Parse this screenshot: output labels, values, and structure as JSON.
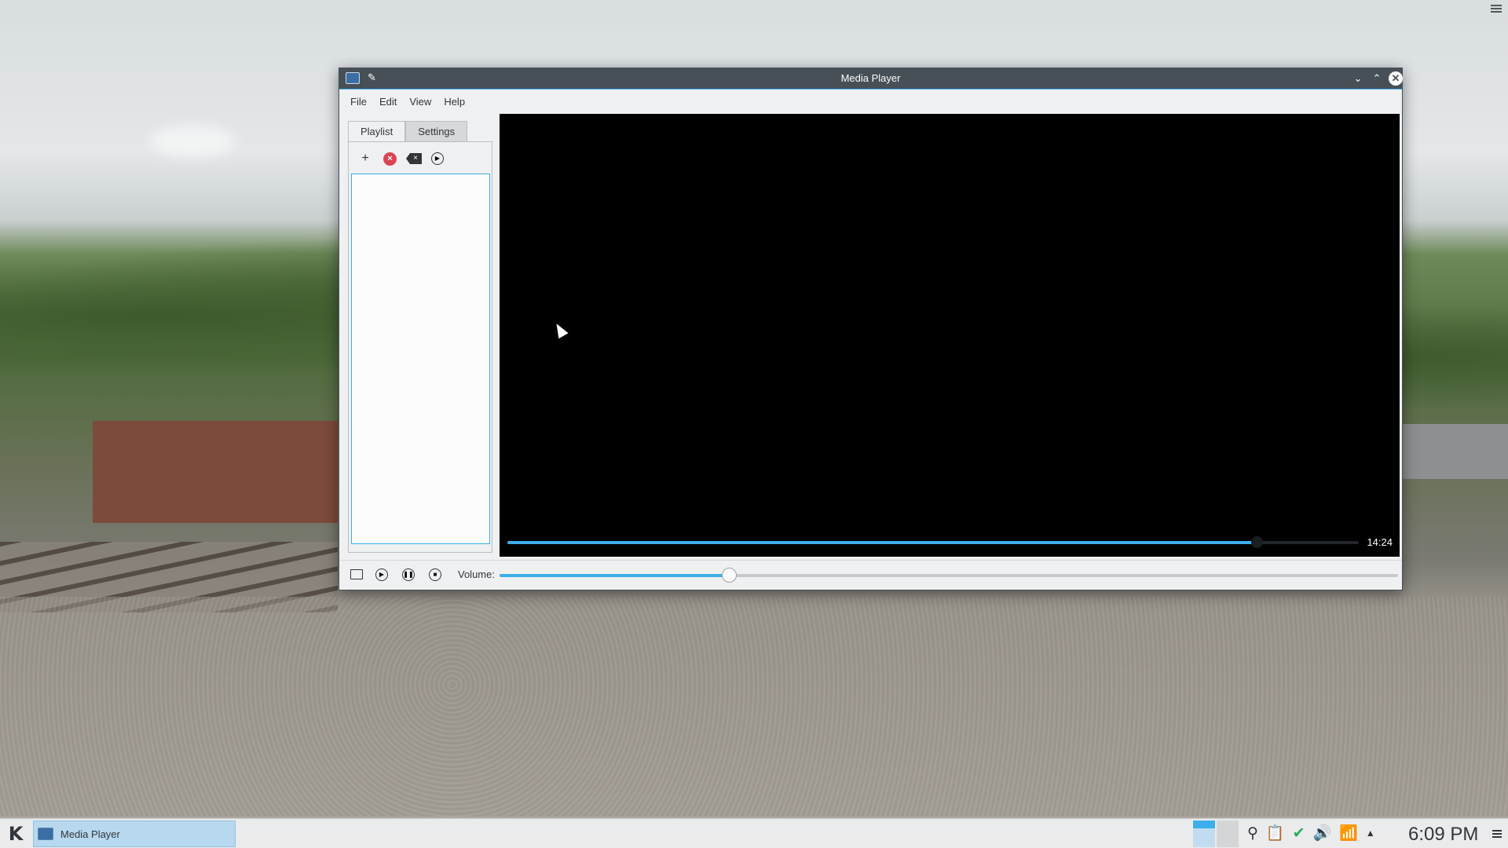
{
  "window": {
    "title": "Media Player",
    "buttons": {
      "minimize": "⌄",
      "maximize": "⌃",
      "close": "✕"
    },
    "pin_icon": "pin-icon"
  },
  "menubar": {
    "items": [
      "File",
      "Edit",
      "View",
      "Help"
    ]
  },
  "tabs": {
    "playlist": "Playlist",
    "settings": "Settings"
  },
  "playlist_toolbar": {
    "add_icon": "plus-icon",
    "remove_icon": "remove-circle-icon",
    "clear_icon": "clear-backspace-icon",
    "play_icon": "play-circle-icon"
  },
  "player": {
    "time": "14:24",
    "progress_fraction": 0.88
  },
  "controls": {
    "volume_label": "Volume:",
    "volume_fraction": 0.255
  },
  "taskbar": {
    "task_label": "Media Player",
    "clock": "6:09 PM"
  },
  "colors": {
    "accent": "#3daee9",
    "titlebar": "#475057",
    "window_bg": "#eff0f1",
    "video_bg": "#000000",
    "remove_red": "#da4453"
  }
}
